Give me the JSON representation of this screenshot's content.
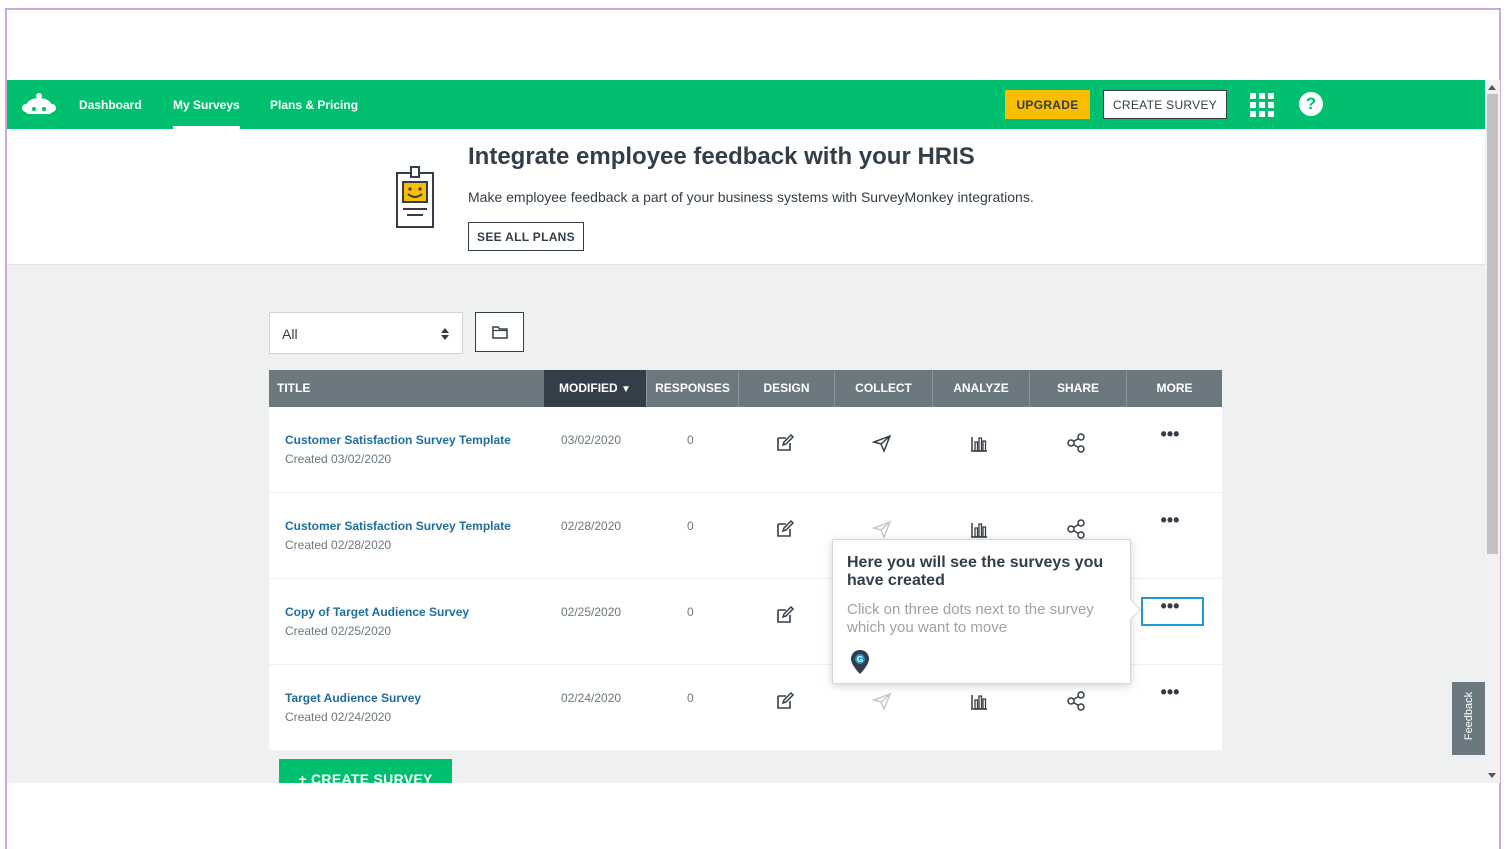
{
  "nav": {
    "links": [
      "Dashboard",
      "My Surveys",
      "Plans & Pricing"
    ],
    "upgrade_label": "UPGRADE",
    "create_survey_label": "CREATE SURVEY",
    "help_label": "?"
  },
  "promo": {
    "title": "Integrate employee feedback with your HRIS",
    "text": "Make employee feedback a part of your business systems with SurveyMonkey integrations.",
    "button_label": "SEE ALL PLANS"
  },
  "filter": {
    "selected": "All"
  },
  "table": {
    "headers": {
      "title": "TITLE",
      "modified": "MODIFIED",
      "responses": "RESPONSES",
      "design": "DESIGN",
      "collect": "COLLECT",
      "analyze": "ANALYZE",
      "share": "SHARE",
      "more": "MORE"
    },
    "rows": [
      {
        "title": "Customer Satisfaction Survey Template",
        "created": "Created 03/02/2020",
        "modified": "03/02/2020",
        "responses": "0"
      },
      {
        "title": "Customer Satisfaction Survey Template",
        "created": "Created 02/28/2020",
        "modified": "02/28/2020",
        "responses": "0"
      },
      {
        "title": "Copy of Target Audience Survey",
        "created": "Created 02/25/2020",
        "modified": "02/25/2020",
        "responses": "0"
      },
      {
        "title": "Target Audience Survey",
        "created": "Created 02/24/2020",
        "modified": "02/24/2020",
        "responses": "0"
      }
    ],
    "more_glyph": "•••"
  },
  "bottom_create_label": "+ CREATE SURVEY",
  "tooltip": {
    "title": "Here you will see the surveys you have created",
    "text": "Click on three dots next to the survey which you want to move"
  },
  "feedback_label": "Feedback",
  "colors": {
    "brand_green": "#00bf6f",
    "upgrade_yellow": "#f9be00",
    "header_gray": "#6b787f",
    "link_blue": "#1e6ea0",
    "highlight_blue": "#1e9bd7"
  },
  "icons": [
    "surveymonkey-logo",
    "apps-grid-icon",
    "help-icon",
    "clipboard-smile-icon",
    "sort-arrows-icon",
    "folder-icon",
    "edit-icon",
    "send-icon",
    "bar-chart-icon",
    "share-icon",
    "more-dots-icon",
    "pin-icon"
  ]
}
